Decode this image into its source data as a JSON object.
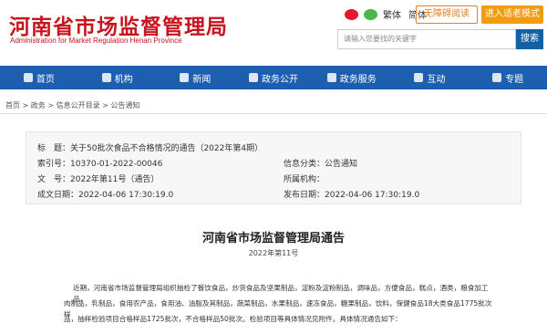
{
  "header": {
    "title": "河南省市场监督管理局",
    "subtitle": "Administration for Market Regulation Henan Province",
    "tools": [
      "繁体",
      "简体"
    ],
    "barrier_btn": "无障碍阅读",
    "elder_btn": "进入适老模式",
    "search_placeholder": "请输入您要找的关键字",
    "search_btn": "搜索"
  },
  "nav": {
    "items": [
      {
        "label": "首页"
      },
      {
        "label": "机构"
      },
      {
        "label": "新闻"
      },
      {
        "label": "政务公开"
      },
      {
        "label": "政务服务"
      },
      {
        "label": "互动"
      },
      {
        "label": "专题"
      }
    ]
  },
  "breadcrumb": "首页 > 政务 > 信息公开目录 > 公告通知",
  "info": {
    "title_line": "标　题：关于50批次食品不合格情况的通告（2022年第4期）",
    "index_no": "索引号：10370-01-2022-00046",
    "category": "信息分类：公告通知",
    "doc_no": "文　号：2022年第11号（通告）",
    "org": "所属机构：",
    "created": "成文日期：2022-04-06 17:30:19.0",
    "published": "发布日期：2022-04-06 17:30:19.0"
  },
  "article": {
    "title": "河南省市场监督管理局通告",
    "sub": "2022年第11号",
    "lines": [
      "近期，河南省市场监督管理局组织抽检了餐饮食品，炒货食品及坚果制品，淀粉及淀粉制品，调味品，方便食品，糕点，酒类，粮食加工品，",
      "肉制品，乳制品，食用农产品，食用油、油脂及其制品，蔬菜制品，水果制品，速冻食品，糖果制品，饮料，保健食品18大类食品1775批次样",
      "品，抽样检验项目合格样品1725批次，不合格样品50批次。检验项目等具体情况见附件。具体情况通告如下："
    ]
  },
  "colors": {
    "brand_red": "#c8141e",
    "nav_blue": "#1d5fae",
    "search_blue": "#1561a8",
    "accent_orange": "#f39c12"
  }
}
